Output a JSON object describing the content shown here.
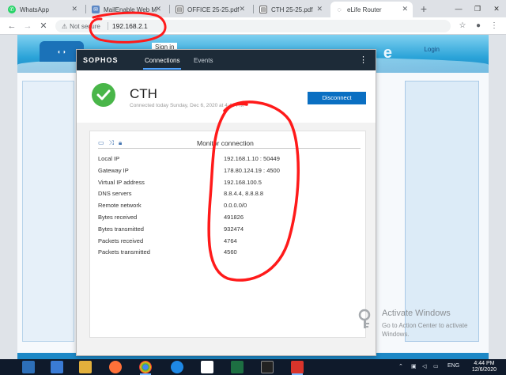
{
  "browser": {
    "tabs": [
      {
        "label": "WhatsApp"
      },
      {
        "label": "MailEnable Web M"
      },
      {
        "label": "OFFICE 25-25.pdf"
      },
      {
        "label": "CTH 25-25.pdf"
      },
      {
        "label": "eLife Router"
      }
    ],
    "address": {
      "security": "Not secure",
      "url": "192.168.2.1"
    }
  },
  "router_page": {
    "signin": "Sign in",
    "login": "Login"
  },
  "sophos": {
    "brand": "SOPHOS",
    "nav": {
      "connections": "Connections",
      "events": "Events"
    },
    "connection": {
      "name": "CTH",
      "subtitle": "Connected today Sunday, Dec 6, 2020 at 4:44 PM",
      "disconnect_label": "Disconnect"
    },
    "card_title": "Monitor connection",
    "details": [
      {
        "label": "Local IP",
        "value": "192.168.1.10 : 50449"
      },
      {
        "label": "Gateway IP",
        "value": "178.80.124.19 : 4500"
      },
      {
        "label": "Virtual IP address",
        "value": "192.168.100.5"
      },
      {
        "label": "DNS servers",
        "value": "8.8.4.4, 8.8.8.8"
      },
      {
        "label": "Remote network",
        "value": "0.0.0.0/0"
      },
      {
        "label": "Bytes received",
        "value": "491826"
      },
      {
        "label": "Bytes transmitted",
        "value": "932474"
      },
      {
        "label": "Packets received",
        "value": "4764"
      },
      {
        "label": "Packets transmitted",
        "value": "4560"
      }
    ]
  },
  "activate_windows": {
    "title": "Activate Windows",
    "message": "Go to Action Center to activate Windows."
  },
  "taskbar": {
    "lang": "ENG",
    "time": "4:44 PM",
    "date": "12/6/2020"
  },
  "colors": {
    "sophos_header": "#1d2b38",
    "success_green": "#49b649",
    "disconnect_blue": "#0a6fc2",
    "annotation_red": "#ff1a1a"
  }
}
